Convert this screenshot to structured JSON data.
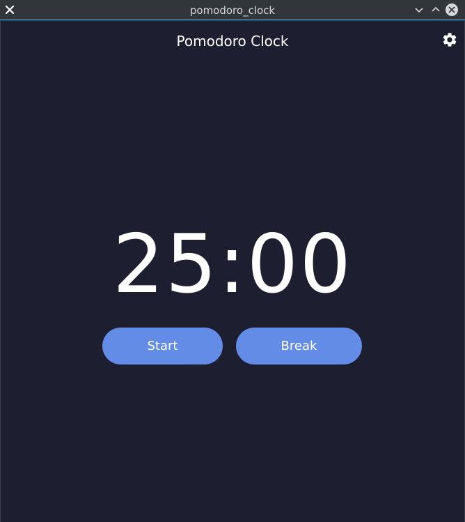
{
  "window": {
    "title": "pomodoro_clock",
    "controls": [
      "close-icon",
      "minimize-icon",
      "maximize-icon",
      "close-window-icon"
    ]
  },
  "app": {
    "title": "Pomodoro Clock",
    "settings_icon": "gear-icon",
    "timer": "25:00",
    "buttons": {
      "start": "Start",
      "break": "Break"
    }
  },
  "colors": {
    "background": "#1e1e31",
    "button": "#638ce6",
    "text": "#ffffff",
    "titlebar": "#31363b",
    "titlebar_accent": "#3daee9"
  }
}
